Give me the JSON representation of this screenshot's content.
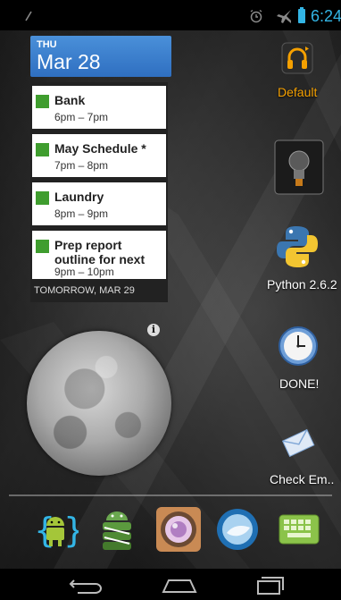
{
  "status_bar": {
    "time": "6:24",
    "icons": [
      "usb-icon",
      "alarm-icon",
      "airplane-icon",
      "battery-icon"
    ],
    "accent": "#33b5e5"
  },
  "calendar": {
    "day": "THU",
    "date": "Mar 28",
    "events": [
      {
        "title": "Bank",
        "time": "6pm – 7pm"
      },
      {
        "title": "May Schedule *",
        "time": "7pm – 8pm"
      },
      {
        "title": "Laundry",
        "time": "8pm – 9pm"
      },
      {
        "title": "Prep report outline for next",
        "time": "9pm – 10pm"
      }
    ],
    "footer": "TOMORROW, MAR 29",
    "event_color": "#3f9d2e"
  },
  "moon": {
    "info_label": "i"
  },
  "apps": [
    {
      "label": "Default",
      "icon": "headphones-icon",
      "label_color": "#f5a000"
    },
    {
      "label": "",
      "icon": "lightbulb-icon"
    },
    {
      "label": "Python 2.6.2",
      "icon": "python-icon"
    },
    {
      "label": "DONE!",
      "icon": "clock-icon"
    },
    {
      "label": "Check Em..",
      "icon": "envelope-icon"
    }
  ],
  "dock": [
    "android-sdk-icon",
    "android-stack-icon",
    "camera-lens-icon",
    "browser-globe-icon",
    "keyboard-icon"
  ],
  "nav": [
    "back-icon",
    "home-icon",
    "recent-apps-icon"
  ]
}
